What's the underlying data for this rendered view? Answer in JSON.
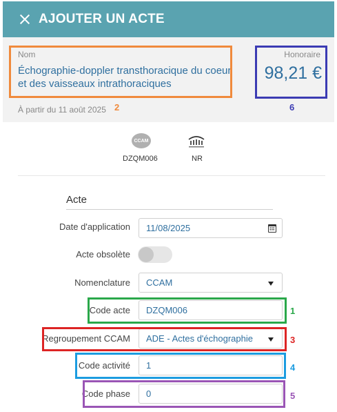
{
  "header": {
    "title": "AJOUTER UN ACTE",
    "close_icon": "close-icon"
  },
  "act": {
    "name_label": "Nom",
    "name": "Échographie-doppler transthoracique du coeur et des vaisseaux intrathoraciques",
    "date_from": "À partir du 11 août 2025",
    "fee_label": "Honoraire",
    "fee": "98,21 €"
  },
  "codes": {
    "ccam_icon_text": "CCAM",
    "ccam_code": "DZQM006",
    "secu_icon": "securite-sociale-logo",
    "secu_code": "NR"
  },
  "form": {
    "section_title": "Acte",
    "date_label": "Date d'application",
    "date_value": "11/08/2025",
    "obsolete_label": "Acte obsolète",
    "obsolete_on": false,
    "nomenclature_label": "Nomenclature",
    "nomenclature_value": "CCAM",
    "code_acte_label": "Code acte",
    "code_acte_value": "DZQM006",
    "regroupement_label": "Regroupement CCAM",
    "regroupement_value": "ADE - Actes d'échographie",
    "activite_label": "Code activité",
    "activite_value": "1",
    "phase_label": "Code phase",
    "phase_value": "0"
  },
  "annotations": {
    "n1": "1",
    "n2": "2",
    "n3": "3",
    "n4": "4",
    "n5": "5",
    "n6": "6",
    "colors": {
      "orange": "#f08a3c",
      "navy": "#3b3bb3",
      "green": "#2aa84a",
      "red": "#dd2424",
      "blue": "#1c9ce0",
      "purple": "#9a55b5"
    }
  },
  "theme": {
    "header_bg": "#5aa3b0",
    "value_text": "#2f6f9f"
  }
}
